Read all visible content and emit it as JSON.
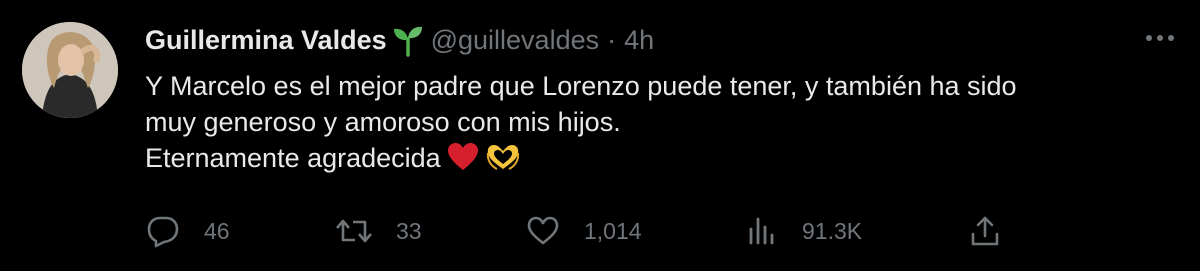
{
  "tweet": {
    "author_name": "Guillermina Valdes",
    "verified_badge_icon": "sprout-icon",
    "handle": "@guillevaldes",
    "separator": "·",
    "time": "4h",
    "more_icon": "more-icon",
    "text_lines": [
      "Y Marcelo es el mejor padre que Lorenzo puede tener, y también ha sido",
      "muy generoso y amoroso con mis hijos.",
      "Eternamente agradecida"
    ],
    "emojis": [
      "red-heart-icon",
      "heart-hands-icon"
    ]
  },
  "actions": {
    "reply": {
      "icon": "reply-icon",
      "count": "46"
    },
    "retweet": {
      "icon": "retweet-icon",
      "count": "33"
    },
    "like": {
      "icon": "like-icon",
      "count": "1,014"
    },
    "views": {
      "icon": "views-icon",
      "count": "91.3K"
    },
    "share": {
      "icon": "share-icon"
    }
  },
  "colors": {
    "background": "#000000",
    "primary_text": "#e7e9ea",
    "secondary_text": "#71767b",
    "heart": "#d61f2d",
    "sprout": "#4caf50"
  }
}
